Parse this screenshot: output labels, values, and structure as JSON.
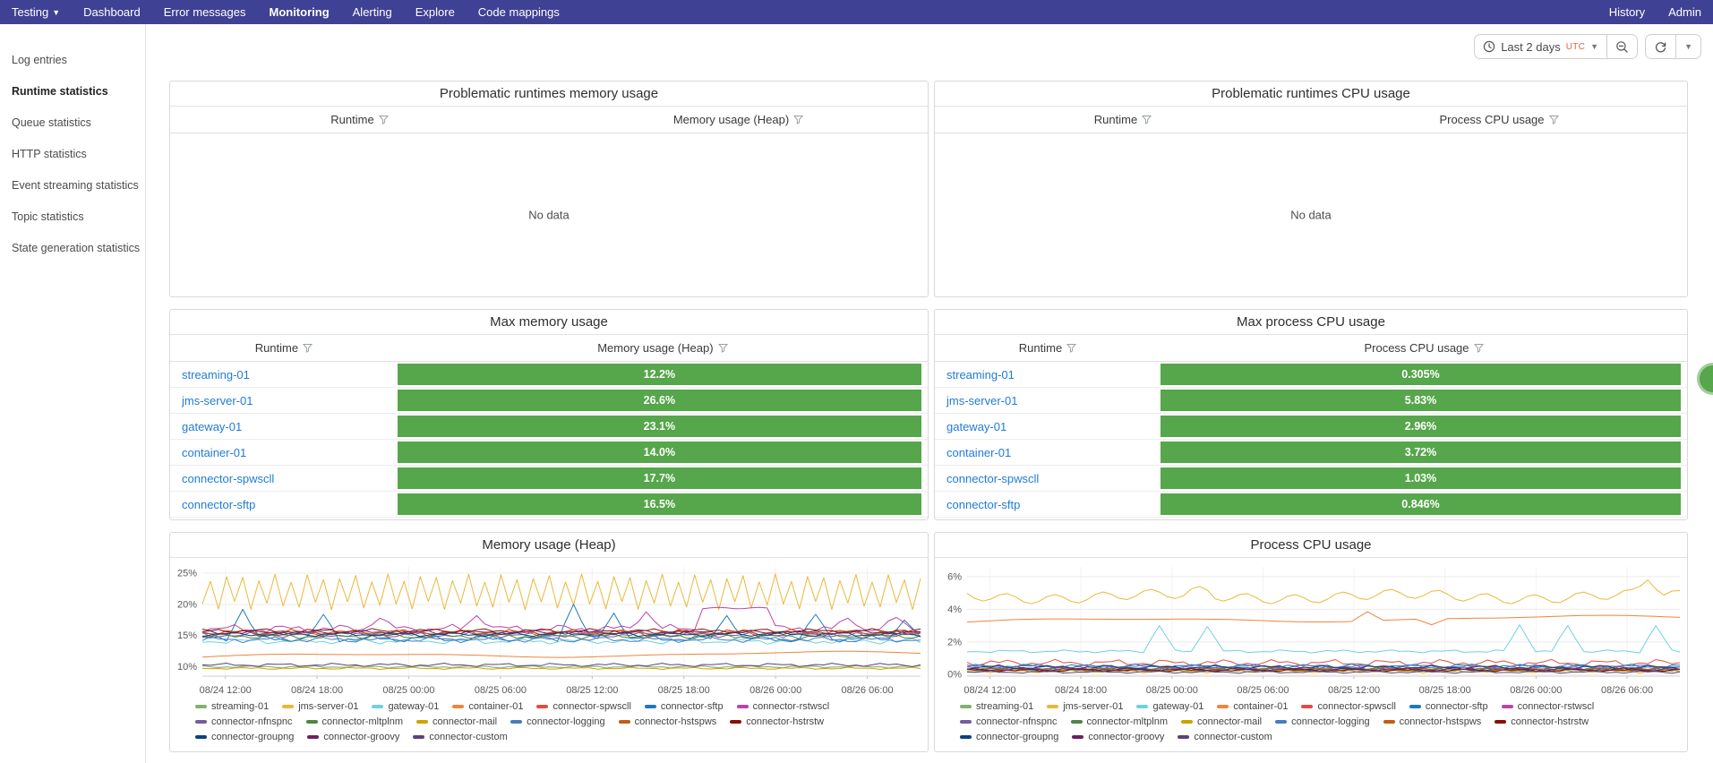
{
  "navbar": {
    "items": [
      {
        "label": "Testing",
        "dropdown": true,
        "active": false
      },
      {
        "label": "Dashboard",
        "dropdown": false,
        "active": false
      },
      {
        "label": "Error messages",
        "dropdown": false,
        "active": false
      },
      {
        "label": "Monitoring",
        "dropdown": false,
        "active": true
      },
      {
        "label": "Alerting",
        "dropdown": false,
        "active": false
      },
      {
        "label": "Explore",
        "dropdown": false,
        "active": false
      },
      {
        "label": "Code mappings",
        "dropdown": false,
        "active": false
      }
    ],
    "right_items": [
      {
        "label": "History"
      },
      {
        "label": "Admin"
      }
    ]
  },
  "sidebar": {
    "items": [
      {
        "label": "Log entries",
        "active": false
      },
      {
        "label": "Runtime statistics",
        "active": true
      },
      {
        "label": "Queue statistics",
        "active": false
      },
      {
        "label": "HTTP statistics",
        "active": false
      },
      {
        "label": "Event streaming statistics",
        "active": false
      },
      {
        "label": "Topic statistics",
        "active": false
      },
      {
        "label": "State generation statistics",
        "active": false
      }
    ]
  },
  "toolbar": {
    "time_range_label": "Last 2 days",
    "timezone_label": "UTC",
    "icons": [
      "clock-icon",
      "chevron-down-icon",
      "zoom-out-icon",
      "refresh-icon",
      "chevron-down-icon"
    ]
  },
  "colors": {
    "navbar_bg": "#3f4194",
    "bar_green": "#56A64B",
    "link_blue": "#1f7bd9",
    "utc_orange": "#e8643f"
  },
  "panels": {
    "problematic_memory": {
      "title": "Problematic runtimes memory usage",
      "columns": [
        "Runtime",
        "Memory usage (Heap)"
      ],
      "empty_text": "No data"
    },
    "problematic_cpu": {
      "title": "Problematic runtimes CPU usage",
      "columns": [
        "Runtime",
        "Process CPU usage"
      ],
      "empty_text": "No data"
    },
    "max_memory": {
      "title": "Max memory usage",
      "columns": [
        "Runtime",
        "Memory usage (Heap)"
      ],
      "rows": [
        {
          "runtime": "streaming-01",
          "value": "12.2%"
        },
        {
          "runtime": "jms-server-01",
          "value": "26.6%"
        },
        {
          "runtime": "gateway-01",
          "value": "23.1%"
        },
        {
          "runtime": "container-01",
          "value": "14.0%"
        },
        {
          "runtime": "connector-spwscll",
          "value": "17.7%"
        },
        {
          "runtime": "connector-sftp",
          "value": "16.5%"
        }
      ]
    },
    "max_cpu": {
      "title": "Max process CPU usage",
      "columns": [
        "Runtime",
        "Process CPU usage"
      ],
      "rows": [
        {
          "runtime": "streaming-01",
          "value": "0.305%"
        },
        {
          "runtime": "jms-server-01",
          "value": "5.83%"
        },
        {
          "runtime": "gateway-01",
          "value": "2.96%"
        },
        {
          "runtime": "container-01",
          "value": "3.72%"
        },
        {
          "runtime": "connector-spwscll",
          "value": "1.03%"
        },
        {
          "runtime": "connector-sftp",
          "value": "0.846%"
        }
      ]
    }
  },
  "chart_data": [
    {
      "type": "line",
      "title": "Memory usage (Heap)",
      "x_ticks": [
        "08/24 12:00",
        "08/24 18:00",
        "08/25 00:00",
        "08/25 06:00",
        "08/25 12:00",
        "08/25 18:00",
        "08/26 00:00",
        "08/26 06:00"
      ],
      "y_ticks": [
        "10%",
        "15%",
        "20%",
        "25%"
      ],
      "y_tick_values": [
        10,
        15,
        20,
        25
      ],
      "ylim": [
        8.5,
        26
      ],
      "grid": true,
      "legend_position": "bottom",
      "series": [
        {
          "name": "streaming-01",
          "color": "#7EB26D",
          "base": 10.0,
          "amp": 0.22,
          "pattern": "noisy"
        },
        {
          "name": "jms-server-01",
          "color": "#EAB839",
          "base": 22.0,
          "amp": 2.2,
          "pattern": "zigzag"
        },
        {
          "name": "gateway-01",
          "color": "#6ED0E6",
          "base": 14.1,
          "amp": 0.5,
          "pattern": "noisy"
        },
        {
          "name": "container-01",
          "color": "#EF843C",
          "base": 11.9,
          "amp": 0.3,
          "pattern": "slow",
          "trend": 0.5
        },
        {
          "name": "connector-spwscll",
          "color": "#E24D42",
          "base": 15.4,
          "amp": 0.65,
          "pattern": "noisy"
        },
        {
          "name": "connector-sftp",
          "color": "#1F78C1",
          "base": 14.5,
          "amp": 0.55,
          "pattern": "noisy",
          "spikes": [
            [
              0.06,
              19.2
            ],
            [
              0.17,
              18.4
            ],
            [
              0.52,
              20.0
            ],
            [
              0.575,
              18.6
            ],
            [
              0.73,
              18.2
            ],
            [
              0.85,
              18.4
            ],
            [
              0.975,
              17.5
            ]
          ]
        },
        {
          "name": "connector-rstwscl",
          "color": "#BA43A9",
          "base": 16.1,
          "amp": 0.7,
          "pattern": "noisy",
          "plateau": [
            0.69,
            0.79,
            19.4
          ],
          "spikes": [
            [
              0.25,
              17.8
            ],
            [
              0.38,
              18.2
            ],
            [
              0.62,
              18.8
            ],
            [
              0.9,
              17.8
            ],
            [
              0.965,
              17.9
            ]
          ]
        },
        {
          "name": "connector-nfnspnc",
          "color": "#705DA0",
          "base": 15.1,
          "amp": 0.45,
          "pattern": "noisy"
        },
        {
          "name": "connector-mltplnm",
          "color": "#508642",
          "base": 14.9,
          "amp": 0.45,
          "pattern": "noisy"
        },
        {
          "name": "connector-mail",
          "color": "#CCA300",
          "base": 9.75,
          "amp": 0.18,
          "pattern": "noisy"
        },
        {
          "name": "connector-logging",
          "color": "#447EBC",
          "base": 14.35,
          "amp": 0.5,
          "pattern": "noisy"
        },
        {
          "name": "connector-hstspws",
          "color": "#C15C17",
          "base": 15.55,
          "amp": 0.45,
          "pattern": "noisy"
        },
        {
          "name": "connector-hstrstw",
          "color": "#890F02",
          "base": 15.75,
          "amp": 0.4,
          "pattern": "noisy"
        },
        {
          "name": "connector-groupng",
          "color": "#0A437C",
          "base": 15.2,
          "amp": 0.4,
          "pattern": "noisy"
        },
        {
          "name": "connector-groovy",
          "color": "#6D1F62",
          "base": 15.5,
          "amp": 0.38,
          "pattern": "noisy"
        },
        {
          "name": "connector-custom",
          "color": "#584477",
          "base": 10.3,
          "amp": 0.3,
          "pattern": "noisy"
        }
      ]
    },
    {
      "type": "line",
      "title": "Process CPU usage",
      "x_ticks": [
        "08/24 12:00",
        "08/24 18:00",
        "08/25 00:00",
        "08/25 06:00",
        "08/25 12:00",
        "08/25 18:00",
        "08/26 00:00",
        "08/26 06:00"
      ],
      "y_ticks": [
        "0%",
        "2%",
        "4%",
        "6%"
      ],
      "y_tick_values": [
        0,
        2,
        4,
        6
      ],
      "ylim": [
        -0.1,
        6.6
      ],
      "grid": true,
      "legend_position": "bottom",
      "series": [
        {
          "name": "streaming-01",
          "color": "#7EB26D",
          "base": 0.25,
          "amp": 0.1,
          "pattern": "noisy"
        },
        {
          "name": "jms-server-01",
          "color": "#EAB839",
          "base": 4.78,
          "amp": 0.38,
          "pattern": "wavy",
          "spikes": [
            [
              0.33,
              5.4
            ],
            [
              0.955,
              5.8
            ]
          ]
        },
        {
          "name": "gateway-01",
          "color": "#6ED0E6",
          "base": 1.42,
          "amp": 0.1,
          "pattern": "noisy",
          "spikes": [
            [
              0.27,
              3.0
            ],
            [
              0.34,
              2.95
            ],
            [
              0.775,
              3.05
            ],
            [
              0.845,
              3.0
            ],
            [
              0.965,
              3.0
            ]
          ]
        },
        {
          "name": "container-01",
          "color": "#EF843C",
          "base": 3.38,
          "amp": 0.12,
          "pattern": "slow",
          "trend": 0.25,
          "spikes": [
            [
              0.56,
              3.85
            ],
            [
              0.655,
              3.05
            ]
          ]
        },
        {
          "name": "connector-spwscll",
          "color": "#E24D42",
          "base": 0.72,
          "amp": 0.22,
          "pattern": "noisy"
        },
        {
          "name": "connector-sftp",
          "color": "#1F78C1",
          "base": 0.5,
          "amp": 0.15,
          "pattern": "noisy"
        },
        {
          "name": "connector-rstwscl",
          "color": "#BA43A9",
          "base": 0.45,
          "amp": 0.16,
          "pattern": "noisy"
        },
        {
          "name": "connector-nfnspnc",
          "color": "#705DA0",
          "base": 0.38,
          "amp": 0.13,
          "pattern": "noisy"
        },
        {
          "name": "connector-mltplnm",
          "color": "#508642",
          "base": 0.3,
          "amp": 0.12,
          "pattern": "noisy"
        },
        {
          "name": "connector-mail",
          "color": "#CCA300",
          "base": 0.2,
          "amp": 0.1,
          "pattern": "noisy"
        },
        {
          "name": "connector-logging",
          "color": "#447EBC",
          "base": 0.5,
          "amp": 0.14,
          "pattern": "noisy"
        },
        {
          "name": "connector-hstspws",
          "color": "#C15C17",
          "base": 0.34,
          "amp": 0.12,
          "pattern": "noisy"
        },
        {
          "name": "connector-hstrstw",
          "color": "#890F02",
          "base": 0.26,
          "amp": 0.1,
          "pattern": "noisy"
        },
        {
          "name": "connector-groupng",
          "color": "#0A437C",
          "base": 0.44,
          "amp": 0.14,
          "pattern": "noisy"
        },
        {
          "name": "connector-groovy",
          "color": "#6D1F62",
          "base": 0.3,
          "amp": 0.1,
          "pattern": "noisy"
        },
        {
          "name": "connector-custom",
          "color": "#584477",
          "base": 0.15,
          "amp": 0.08,
          "pattern": "noisy"
        }
      ]
    }
  ]
}
